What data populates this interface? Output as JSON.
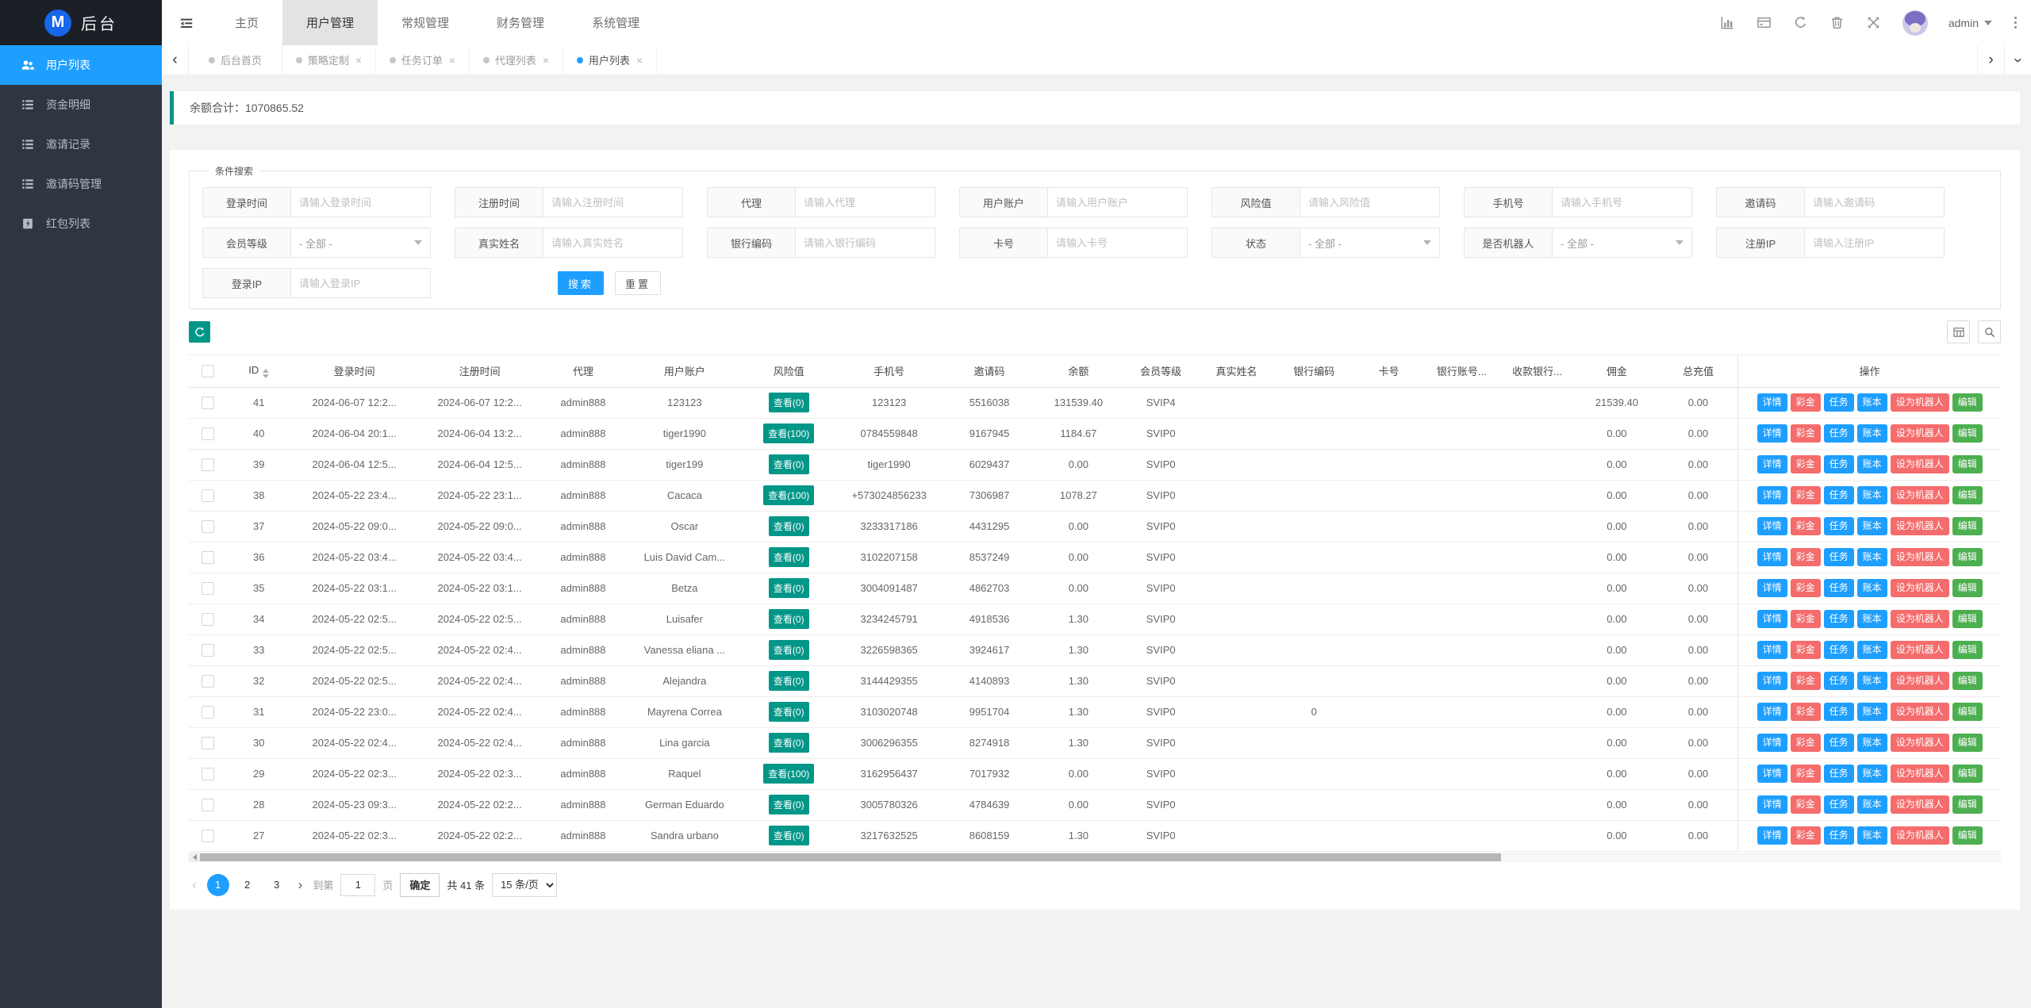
{
  "colors": {
    "accent_blue": "#1E9FFF",
    "teal": "#009688",
    "red": "#F56C6C",
    "green": "#4CAF50",
    "sidebar_bg": "#2f3642",
    "logo_bg": "#1b1f27"
  },
  "icons": {
    "tab_close": "×",
    "chevron_left": "‹",
    "chevron_right": "›"
  },
  "header": {
    "logo_letter": "M",
    "logo_text": "后台",
    "nav_items": [
      {
        "label": "主页",
        "active": false
      },
      {
        "label": "用户管理",
        "active": true
      },
      {
        "label": "常规管理",
        "active": false
      },
      {
        "label": "财务管理",
        "active": false
      },
      {
        "label": "系统管理",
        "active": false
      }
    ],
    "username": "admin"
  },
  "tabbar": {
    "left_chevron": "‹",
    "right_chevron": "›",
    "tabs": [
      {
        "label": "后台首页",
        "active": false,
        "closable": false
      },
      {
        "label": "策略定制",
        "active": false,
        "closable": true
      },
      {
        "label": "任务订单",
        "active": false,
        "closable": true
      },
      {
        "label": "代理列表",
        "active": false,
        "closable": true
      },
      {
        "label": "用户列表",
        "active": true,
        "closable": true
      }
    ]
  },
  "sidebar": {
    "items": [
      {
        "label": "用户列表",
        "icon": "users-icon",
        "active": true
      },
      {
        "label": "资金明细",
        "icon": "list-icon",
        "active": false
      },
      {
        "label": "邀请记录",
        "icon": "list-icon",
        "active": false
      },
      {
        "label": "邀请码管理",
        "icon": "list-icon",
        "active": false
      },
      {
        "label": "红包列表",
        "icon": "red-packet-icon",
        "active": false
      }
    ]
  },
  "summary": {
    "label": "余额合计：",
    "value": "1070865.52"
  },
  "search": {
    "legend": "条件搜索",
    "fields": [
      {
        "name": "login-time",
        "label": "登录时间",
        "placeholder": "请输入登录时间",
        "type": "input"
      },
      {
        "name": "register-time",
        "label": "注册时间",
        "placeholder": "请输入注册时间",
        "type": "input"
      },
      {
        "name": "agent",
        "label": "代理",
        "placeholder": "请输入代理",
        "type": "input"
      },
      {
        "name": "user-account",
        "label": "用户账户",
        "placeholder": "请输入用户账户",
        "type": "input"
      },
      {
        "name": "risk-value",
        "label": "风险值",
        "placeholder": "请输入风险值",
        "type": "input"
      },
      {
        "name": "phone",
        "label": "手机号",
        "placeholder": "请输入手机号",
        "type": "input"
      },
      {
        "name": "invite-code",
        "label": "邀请码",
        "placeholder": "请输入邀请码",
        "type": "input"
      },
      {
        "name": "member-level",
        "label": "会员等级",
        "value": "- 全部 -",
        "type": "select"
      },
      {
        "name": "real-name",
        "label": "真实姓名",
        "placeholder": "请输入真实姓名",
        "type": "input"
      },
      {
        "name": "bank-code",
        "label": "银行编码",
        "placeholder": "请输入银行编码",
        "type": "input"
      },
      {
        "name": "card-no",
        "label": "卡号",
        "placeholder": "请输入卡号",
        "type": "input"
      },
      {
        "name": "status",
        "label": "状态",
        "value": "- 全部 -",
        "type": "select"
      },
      {
        "name": "is-robot",
        "label": "是否机器人",
        "value": "- 全部 -",
        "type": "select"
      },
      {
        "name": "register-ip",
        "label": "注册IP",
        "placeholder": "请输入注册IP",
        "type": "input"
      },
      {
        "name": "login-ip",
        "label": "登录IP",
        "placeholder": "请输入登录IP",
        "type": "input"
      }
    ],
    "search_button": "搜索",
    "reset_button": "重置"
  },
  "table": {
    "columns": [
      "ID",
      "登录时间",
      "注册时间",
      "代理",
      "用户账户",
      "风险值",
      "手机号",
      "邀请码",
      "余额",
      "会员等级",
      "真实姓名",
      "银行编码",
      "卡号",
      "银行账号...",
      "收款银行...",
      "佣金",
      "总充值"
    ],
    "actions_column": "操作",
    "action_buttons": [
      {
        "label": "详情",
        "color": "blue"
      },
      {
        "label": "彩金",
        "color": "red"
      },
      {
        "label": "任务",
        "color": "blue"
      },
      {
        "label": "账本",
        "color": "blue"
      },
      {
        "label": "设为机器人",
        "color": "red"
      },
      {
        "label": "编辑",
        "color": "green"
      }
    ],
    "rows": [
      {
        "id": "41",
        "login_time": "2024-06-07 12:2...",
        "register_time": "2024-06-07 12:2...",
        "agent": "admin888",
        "account": "123123",
        "risk": "查看(0)",
        "phone": "123123",
        "invite_code": "5516038",
        "balance": "131539.40",
        "level": "SVIP4",
        "real_name": "",
        "bank_code": "",
        "card_no": "",
        "bank_account": "",
        "receive_bank": "",
        "commission": "21539.40",
        "total_recharge": "0.00"
      },
      {
        "id": "40",
        "login_time": "2024-06-04 20:1...",
        "register_time": "2024-06-04 13:2...",
        "agent": "admin888",
        "account": "tiger1990",
        "risk": "查看(100)",
        "phone": "0784559848",
        "invite_code": "9167945",
        "balance": "1184.67",
        "level": "SVIP0",
        "real_name": "",
        "bank_code": "",
        "card_no": "",
        "bank_account": "",
        "receive_bank": "",
        "commission": "0.00",
        "total_recharge": "0.00"
      },
      {
        "id": "39",
        "login_time": "2024-06-04 12:5...",
        "register_time": "2024-06-04 12:5...",
        "agent": "admin888",
        "account": "tiger199",
        "risk": "查看(0)",
        "phone": "tiger1990",
        "invite_code": "6029437",
        "balance": "0.00",
        "level": "SVIP0",
        "real_name": "",
        "bank_code": "",
        "card_no": "",
        "bank_account": "",
        "receive_bank": "",
        "commission": "0.00",
        "total_recharge": "0.00"
      },
      {
        "id": "38",
        "login_time": "2024-05-22 23:4...",
        "register_time": "2024-05-22 23:1...",
        "agent": "admin888",
        "account": "Cacaca",
        "risk": "查看(100)",
        "phone": "+573024856233",
        "invite_code": "7306987",
        "balance": "1078.27",
        "level": "SVIP0",
        "real_name": "",
        "bank_code": "",
        "card_no": "",
        "bank_account": "",
        "receive_bank": "",
        "commission": "0.00",
        "total_recharge": "0.00"
      },
      {
        "id": "37",
        "login_time": "2024-05-22 09:0...",
        "register_time": "2024-05-22 09:0...",
        "agent": "admin888",
        "account": "Oscar",
        "risk": "查看(0)",
        "phone": "3233317186",
        "invite_code": "4431295",
        "balance": "0.00",
        "level": "SVIP0",
        "real_name": "",
        "bank_code": "",
        "card_no": "",
        "bank_account": "",
        "receive_bank": "",
        "commission": "0.00",
        "total_recharge": "0.00"
      },
      {
        "id": "36",
        "login_time": "2024-05-22 03:4...",
        "register_time": "2024-05-22 03:4...",
        "agent": "admin888",
        "account": "Luis David Cam...",
        "risk": "查看(0)",
        "phone": "3102207158",
        "invite_code": "8537249",
        "balance": "0.00",
        "level": "SVIP0",
        "real_name": "",
        "bank_code": "",
        "card_no": "",
        "bank_account": "",
        "receive_bank": "",
        "commission": "0.00",
        "total_recharge": "0.00"
      },
      {
        "id": "35",
        "login_time": "2024-05-22 03:1...",
        "register_time": "2024-05-22 03:1...",
        "agent": "admin888",
        "account": "Betza",
        "risk": "查看(0)",
        "phone": "3004091487",
        "invite_code": "4862703",
        "balance": "0.00",
        "level": "SVIP0",
        "real_name": "",
        "bank_code": "",
        "card_no": "",
        "bank_account": "",
        "receive_bank": "",
        "commission": "0.00",
        "total_recharge": "0.00"
      },
      {
        "id": "34",
        "login_time": "2024-05-22 02:5...",
        "register_time": "2024-05-22 02:5...",
        "agent": "admin888",
        "account": "Luisafer",
        "risk": "查看(0)",
        "phone": "3234245791",
        "invite_code": "4918536",
        "balance": "1.30",
        "level": "SVIP0",
        "real_name": "",
        "bank_code": "",
        "card_no": "",
        "bank_account": "",
        "receive_bank": "",
        "commission": "0.00",
        "total_recharge": "0.00"
      },
      {
        "id": "33",
        "login_time": "2024-05-22 02:5...",
        "register_time": "2024-05-22 02:4...",
        "agent": "admin888",
        "account": "Vanessa eliana ...",
        "risk": "查看(0)",
        "phone": "3226598365",
        "invite_code": "3924617",
        "balance": "1.30",
        "level": "SVIP0",
        "real_name": "",
        "bank_code": "",
        "card_no": "",
        "bank_account": "",
        "receive_bank": "",
        "commission": "0.00",
        "total_recharge": "0.00"
      },
      {
        "id": "32",
        "login_time": "2024-05-22 02:5...",
        "register_time": "2024-05-22 02:4...",
        "agent": "admin888",
        "account": "Alejandra",
        "risk": "查看(0)",
        "phone": "3144429355",
        "invite_code": "4140893",
        "balance": "1.30",
        "level": "SVIP0",
        "real_name": "",
        "bank_code": "",
        "card_no": "",
        "bank_account": "",
        "receive_bank": "",
        "commission": "0.00",
        "total_recharge": "0.00"
      },
      {
        "id": "31",
        "login_time": "2024-05-22 23:0...",
        "register_time": "2024-05-22 02:4...",
        "agent": "admin888",
        "account": "Mayrena Correa",
        "risk": "查看(0)",
        "phone": "3103020748",
        "invite_code": "9951704",
        "balance": "1.30",
        "level": "SVIP0",
        "real_name": "",
        "bank_code": "0",
        "card_no": "",
        "bank_account": "",
        "receive_bank": "",
        "commission": "0.00",
        "total_recharge": "0.00"
      },
      {
        "id": "30",
        "login_time": "2024-05-22 02:4...",
        "register_time": "2024-05-22 02:4...",
        "agent": "admin888",
        "account": "Lina garcia",
        "risk": "查看(0)",
        "phone": "3006296355",
        "invite_code": "8274918",
        "balance": "1.30",
        "level": "SVIP0",
        "real_name": "",
        "bank_code": "",
        "card_no": "",
        "bank_account": "",
        "receive_bank": "",
        "commission": "0.00",
        "total_recharge": "0.00"
      },
      {
        "id": "29",
        "login_time": "2024-05-22 02:3...",
        "register_time": "2024-05-22 02:3...",
        "agent": "admin888",
        "account": "Raquel",
        "risk": "查看(100)",
        "phone": "3162956437",
        "invite_code": "7017932",
        "balance": "0.00",
        "level": "SVIP0",
        "real_name": "",
        "bank_code": "",
        "card_no": "",
        "bank_account": "",
        "receive_bank": "",
        "commission": "0.00",
        "total_recharge": "0.00"
      },
      {
        "id": "28",
        "login_time": "2024-05-23 09:3...",
        "register_time": "2024-05-22 02:2...",
        "agent": "admin888",
        "account": "German Eduardo",
        "risk": "查看(0)",
        "phone": "3005780326",
        "invite_code": "4784639",
        "balance": "0.00",
        "level": "SVIP0",
        "real_name": "",
        "bank_code": "",
        "card_no": "",
        "bank_account": "",
        "receive_bank": "",
        "commission": "0.00",
        "total_recharge": "0.00"
      },
      {
        "id": "27",
        "login_time": "2024-05-22 02:3...",
        "register_time": "2024-05-22 02:2...",
        "agent": "admin888",
        "account": "Sandra urbano",
        "risk": "查看(0)",
        "phone": "3217632525",
        "invite_code": "8608159",
        "balance": "1.30",
        "level": "SVIP0",
        "real_name": "",
        "bank_code": "",
        "card_no": "",
        "bank_account": "",
        "receive_bank": "",
        "commission": "0.00",
        "total_recharge": "0.00"
      }
    ]
  },
  "pagination": {
    "prev": "‹",
    "next": "›",
    "pages": [
      "1",
      "2",
      "3"
    ],
    "active_page": "1",
    "goto_label": "到第",
    "goto_value": "1",
    "page_label": "页",
    "confirm": "确定",
    "total": "共 41 条",
    "page_size": "15 条/页"
  }
}
